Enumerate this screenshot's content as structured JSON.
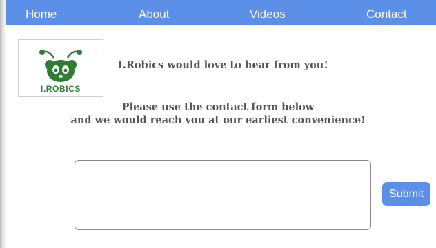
{
  "nav": {
    "home": "Home",
    "about": "About",
    "videos": "Videos",
    "contact": "Contact"
  },
  "logo": {
    "text": "I.ROBICS",
    "icon": "robot-panda-logo-icon",
    "color": "#2e7d32"
  },
  "content": {
    "tagline": "I.Robics would love to hear from you!",
    "instructions_line1": "Please use the contact form below",
    "instructions_line2": "and we would reach you at our earliest convenience!"
  },
  "form": {
    "message_value": "",
    "submit_label": "Submit"
  },
  "colors": {
    "accent": "#5b8fe8",
    "text": "#555555"
  }
}
